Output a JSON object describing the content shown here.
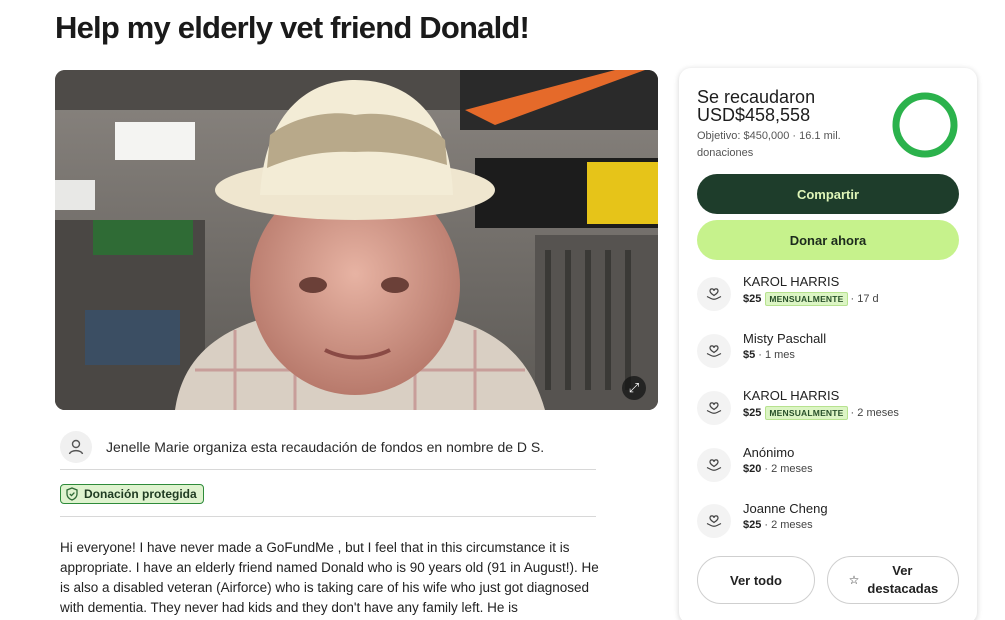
{
  "title": "Help my elderly vet friend Donald!",
  "organizer_text": "Jenelle Marie organiza esta recaudación de fondos en nombre de D S.",
  "protected_label": "Donación protegida",
  "story": "Hi everyone! I have never made a GoFundMe , but I feel that in this circumstance it is appropriate. I have an elderly friend named Donald who is 90 years old (91 in August!). He is also a disabled veteran (Airforce) who is taking care of his wife who just got diagnosed with dementia. They never had kids and they don't have any family left. He is",
  "card": {
    "raised_label": "Se recaudaron",
    "raised_amount": "USD$458,558",
    "goal_line": "Objetivo: $450,000 · 16.1 mil. donaciones",
    "progress_fraction": 1.0,
    "share_label": "Compartir",
    "donate_label": "Donar ahora",
    "donors": [
      {
        "name": "KAROL HARRIS",
        "amount": "$25",
        "badge": "MENSUALMENTE",
        "time": "· 17 d"
      },
      {
        "name": "Misty Paschall",
        "amount": "$5",
        "badge": "",
        "time": "· 1 mes"
      },
      {
        "name": "KAROL HARRIS",
        "amount": "$25",
        "badge": "MENSUALMENTE",
        "time": "· 2 meses"
      },
      {
        "name": "Anónimo",
        "amount": "$20",
        "badge": "",
        "time": "· 2 meses"
      },
      {
        "name": "Joanne Cheng",
        "amount": "$25",
        "badge": "",
        "time": "· 2 meses"
      }
    ],
    "see_all_label": "Ver todo",
    "see_top_label": "Ver destacadas"
  },
  "colors": {
    "share_bg": "#1e3d2b",
    "donate_bg": "#c6f28c",
    "progress": "#2bb24c"
  },
  "icons": {
    "avatar": "user-icon",
    "protected": "shield-icon",
    "donor": "heart-hand-icon",
    "expand": "expand-icon",
    "star": "star-icon"
  }
}
